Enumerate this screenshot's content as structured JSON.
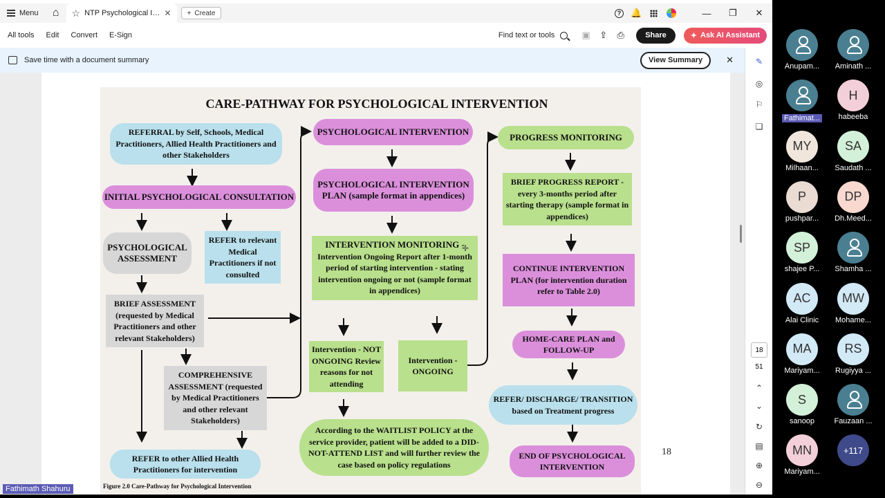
{
  "tabbar": {
    "menu_label": "Menu",
    "tab_title": "NTP Psychological Inter...",
    "create_label": "Create"
  },
  "toolbar": {
    "all_tools": "All tools",
    "edit": "Edit",
    "convert": "Convert",
    "esign": "E-Sign",
    "find": "Find text or tools",
    "share": "Share",
    "ai": "Ask AI Assistant"
  },
  "banner": {
    "text": "Save time with a document summary",
    "button": "View Summary"
  },
  "page_nav": {
    "current": "18",
    "total": "51"
  },
  "diagram": {
    "title": "CARE-PATHWAY FOR PSYCHOLOGICAL INTERVENTION",
    "referral": "REFERRAL by Self, Schools, Medical Practitioners, Allied Health Practitioners and other Stakeholders",
    "initial": "INITIAL PSYCHOLOGICAL CONSULTATION",
    "assessment": "PSYCHOLOGICAL ASSESSMENT",
    "refer_medical": "REFER to relevant Medical Practitioners if not consulted",
    "brief": "BRIEF ASSESSMENT (requested by Medical Practitioners and other relevant Stakeholders)",
    "comprehensive": "COMPREHENSIVE ASSESSMENT (requested by Medical Practitioners and other relevant Stakeholders)",
    "refer_allied": "REFER to other Allied Health Practitioners for intervention",
    "psych_intervention": "PSYCHOLOGICAL INTERVENTION",
    "intervention_plan": "PSYCHOLOGICAL INTERVENTION PLAN (sample format in appendices)",
    "monitoring_title": "INTERVENTION MONITORING -",
    "monitoring_body": "Intervention Ongoing Report after 1-month period of starting intervention - stating intervention ongoing or not (sample format in appendices)",
    "not_ongoing": "Intervention - NOT ONGOING Review reasons for not attending",
    "ongoing": "Intervention - ONGOING",
    "waitlist": "According to the WAITLIST POLICY at the service provider, patient will be added to a DID-NOT-ATTEND LIST and will further review the case based on policy regulations",
    "progress": "PROGRESS MONITORING",
    "brief_progress": "BRIEF PROGRESS REPORT - every 3-months period after starting therapy (sample format in appendices)",
    "continue": "CONTINUE INTERVENTION PLAN (for intervention duration refer to Table 2.0)",
    "homecare": "HOME-CARE PLAN and FOLLOW-UP",
    "refer_discharge": "REFER/ DISCHARGE/ TRANSITION based on Treatment progress",
    "end": "END OF PSYCHOLOGICAL INTERVENTION",
    "caption": "Figure 2.0 Care-Pathway for Psychological Intervention",
    "page_number": "18"
  },
  "participants": [
    {
      "initials": "",
      "name": "Anupam...",
      "color": "#4a7f91"
    },
    {
      "initials": "",
      "name": "Aminath ...",
      "color": "#4a7f91"
    },
    {
      "initials": "",
      "name": "Fathimat...",
      "color": "#4a7f91"
    },
    {
      "initials": "H",
      "name": "habeeba",
      "color": "#f3cfd9"
    },
    {
      "initials": "MY",
      "name": "Milhaan...",
      "color": "#f0e6dc"
    },
    {
      "initials": "SA",
      "name": "Saudath ...",
      "color": "#d3f0d8"
    },
    {
      "initials": "P",
      "name": "pushpar...",
      "color": "#eadbd3"
    },
    {
      "initials": "DP",
      "name": "Dh.Meed...",
      "color": "#f8d8cf"
    },
    {
      "initials": "SP",
      "name": "shajee P...",
      "color": "#d3f0d8"
    },
    {
      "initials": "",
      "name": "Shamha ...",
      "color": "#4a7f91"
    },
    {
      "initials": "AC",
      "name": "Alai Clinic",
      "color": "#d2e9f6"
    },
    {
      "initials": "MW",
      "name": "Mohame...",
      "color": "#d2e9f6"
    },
    {
      "initials": "MA",
      "name": "Mariyam...",
      "color": "#d2e9f6"
    },
    {
      "initials": "RS",
      "name": "Rugiyya ...",
      "color": "#d2e9f6"
    },
    {
      "initials": "S",
      "name": "sanoop",
      "color": "#d3f0d8"
    },
    {
      "initials": "",
      "name": "Fauzaan ...",
      "color": "#4a7f91"
    },
    {
      "initials": "MN",
      "name": "Mariyam...",
      "color": "#f3cfd9"
    },
    {
      "initials": "+117",
      "name": "",
      "color": "#3f4a8a"
    }
  ],
  "active_speaker": "Fathimath Shahuru"
}
